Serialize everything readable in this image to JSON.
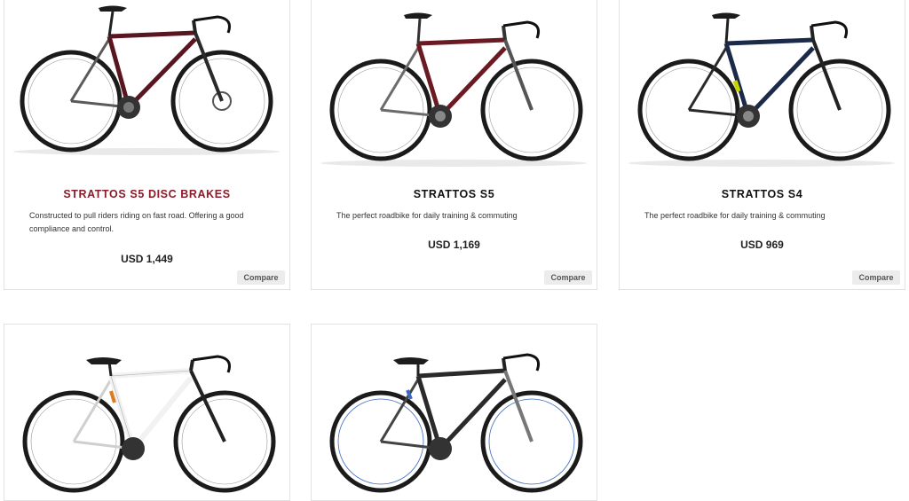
{
  "products": [
    {
      "name": "STRATTOS S5 DISC BRAKES",
      "description": "Constructed to pull riders riding on fast road. Offering a good compliance and control.",
      "price": "USD 1,449",
      "compare_label": "Compare",
      "frame_colors": [
        "#2a2a2a",
        "#5a1620"
      ],
      "accent": "#8b1a2a"
    },
    {
      "name": "STRATTOS S5",
      "description": "The perfect roadbike for daily training & commuting",
      "price": "USD 1,169",
      "compare_label": "Compare",
      "frame_colors": [
        "#6b6b6b",
        "#6a1a22"
      ]
    },
    {
      "name": "STRATTOS S4",
      "description": "The perfect roadbike for daily training & commuting",
      "price": "USD 969",
      "compare_label": "Compare",
      "frame_colors": [
        "#1c2a4a",
        "#c8d400"
      ]
    },
    {
      "frame_colors": [
        "#f2f2f2",
        "#e07a1a"
      ]
    },
    {
      "frame_colors": [
        "#2a2a2a",
        "#3a6bc0"
      ]
    }
  ]
}
